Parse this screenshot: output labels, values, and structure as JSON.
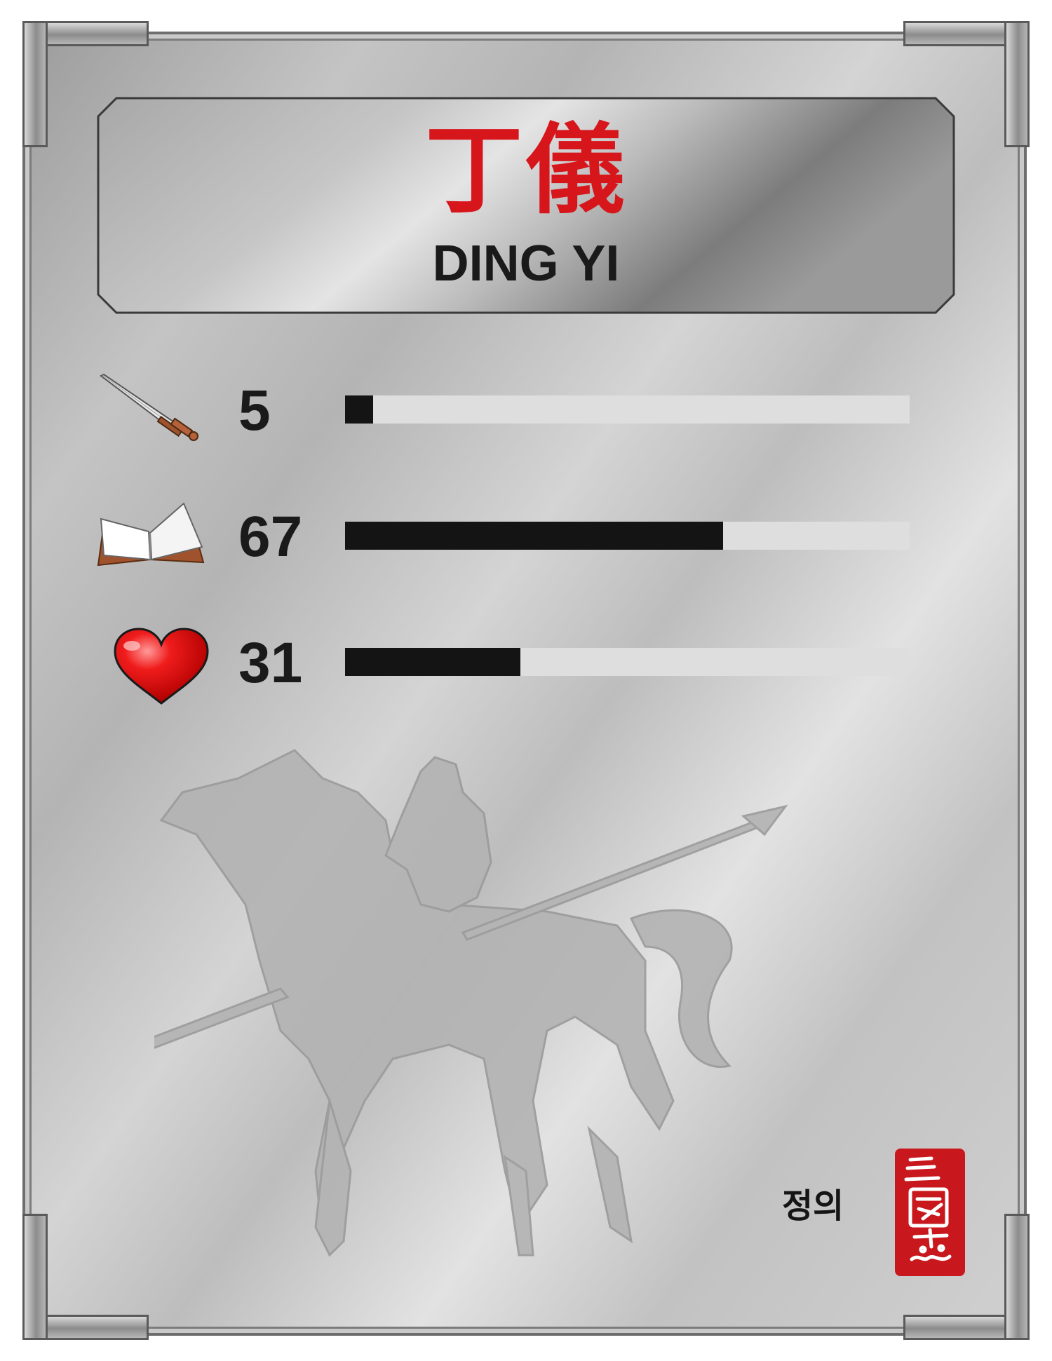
{
  "card": {
    "name_chinese": "丁儀",
    "name_english": "DING YI",
    "name_korean": "정의",
    "seal_text": "三國志"
  },
  "stats": [
    {
      "icon": "sword-icon",
      "value": "5",
      "max": 100
    },
    {
      "icon": "book-icon",
      "value": "67",
      "max": 100
    },
    {
      "icon": "heart-icon",
      "value": "31",
      "max": 100
    }
  ],
  "colors": {
    "name_red": "#d7161c",
    "bar_fill": "#141414",
    "bar_track": "#dedede",
    "seal_red": "#c8181d"
  }
}
